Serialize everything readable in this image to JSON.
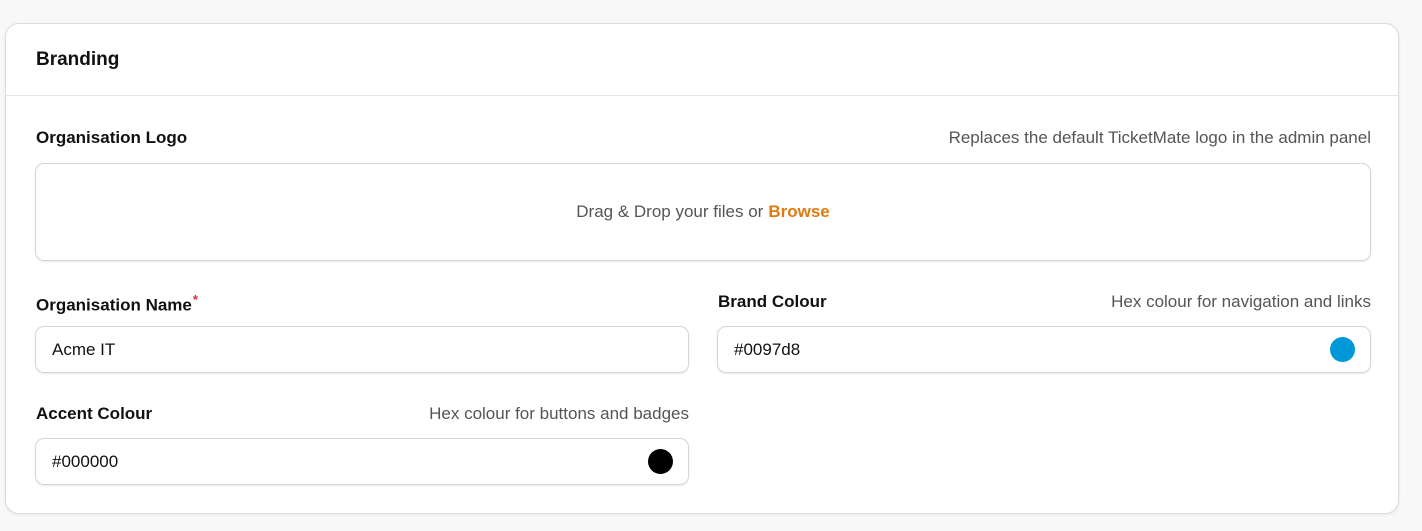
{
  "card": {
    "title": "Branding"
  },
  "logo": {
    "label": "Organisation Logo",
    "hint": "Replaces the default TicketMate logo in the admin panel",
    "dropzone_text": "Drag & Drop your files or",
    "browse_label": "Browse"
  },
  "org_name": {
    "label": "Organisation Name",
    "required_mark": "*",
    "value": "Acme IT"
  },
  "brand_colour": {
    "label": "Brand Colour",
    "hint": "Hex colour for navigation and links",
    "value": "#0097d8",
    "swatch_color": "#0097d8"
  },
  "accent_colour": {
    "label": "Accent Colour",
    "hint": "Hex colour for buttons and badges",
    "value": "#000000",
    "swatch_color": "#000000"
  },
  "colors": {
    "browse_link": "#e07a10",
    "required": "#d32f2f"
  }
}
